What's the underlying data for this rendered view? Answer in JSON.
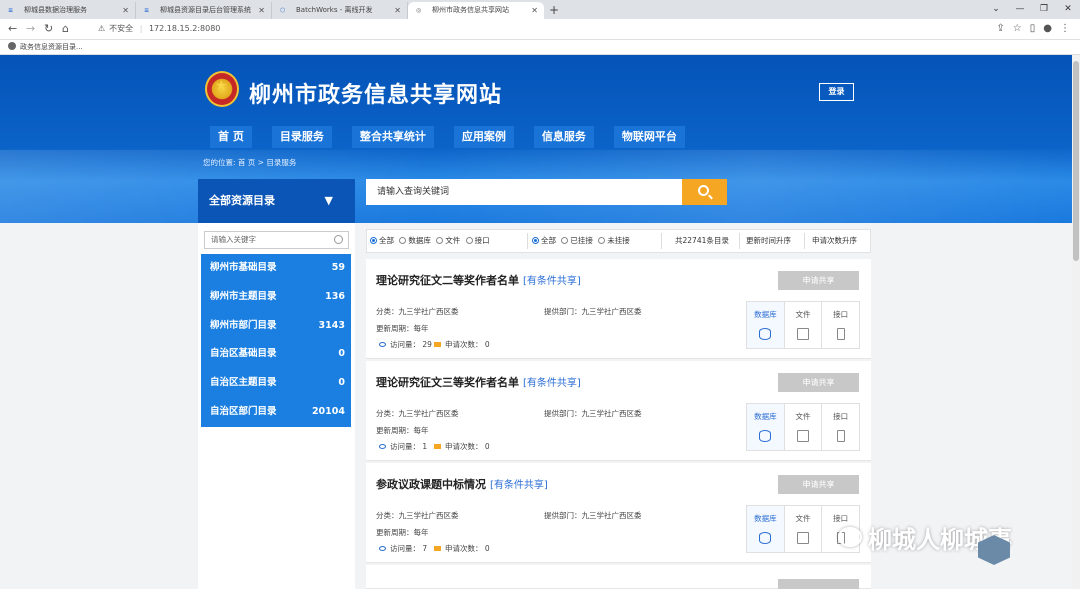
{
  "browser": {
    "tabs": [
      {
        "label": "柳城县数据治理服务",
        "active": false
      },
      {
        "label": "柳城县资源目录后台管理系统",
        "active": false
      },
      {
        "label": "BatchWorks - 离线开发",
        "active": false
      },
      {
        "label": "柳州市政务信息共享网站",
        "active": true
      }
    ],
    "new_tab": "+",
    "insecure_label": "不安全",
    "url": "172.18.15.2:8080",
    "bookmark": "政务信息资源目录..."
  },
  "header": {
    "site_title": "柳州市政务信息共享网站",
    "login": "登录",
    "nav": [
      "首 页",
      "目录服务",
      "整合共享统计",
      "应用案例",
      "信息服务",
      "物联网平台"
    ],
    "breadcrumb": "您的位置: 首 页 > 目录服务"
  },
  "catalog": {
    "title": "全部资源目录",
    "keyword_placeholder": "请输入关键字",
    "items": [
      {
        "name": "柳州市基础目录",
        "count": "59"
      },
      {
        "name": "柳州市主题目录",
        "count": "136"
      },
      {
        "name": "柳州市部门目录",
        "count": "3143"
      },
      {
        "name": "自治区基础目录",
        "count": "0"
      },
      {
        "name": "自治区主题目录",
        "count": "0"
      },
      {
        "name": "自治区部门目录",
        "count": "20104"
      }
    ]
  },
  "search": {
    "placeholder": "请输入查询关键词"
  },
  "filters": {
    "type_options": [
      "全部",
      "数据库",
      "文件",
      "接口"
    ],
    "mount_options": [
      "全部",
      "已挂接",
      "未挂接"
    ],
    "total": "共22741条目录",
    "sort_time": "更新时间升序",
    "sort_apply": "申请次数升序"
  },
  "results": [
    {
      "title": "理论研究征文二等奖作者名单",
      "tag": "[有条件共享]",
      "apply": "申请共享",
      "category": "分类：九三学社广西区委",
      "provider": "提供部门：九三学社广西区委",
      "period": "更新周期：每年",
      "views_label": "访问量：",
      "views": "29",
      "apply_label": "申请次数：",
      "apply_count": "0",
      "types": [
        "数据库",
        "文件",
        "接口"
      ]
    },
    {
      "title": "理论研究征文三等奖作者名单",
      "tag": "[有条件共享]",
      "apply": "申请共享",
      "category": "分类：九三学社广西区委",
      "provider": "提供部门：九三学社广西区委",
      "period": "更新周期：每年",
      "views_label": "访问量：",
      "views": "1",
      "apply_label": "申请次数：",
      "apply_count": "0",
      "types": [
        "数据库",
        "文件",
        "接口"
      ]
    },
    {
      "title": "参政议政课题中标情况",
      "tag": "[有条件共享]",
      "apply": "申请共享",
      "category": "分类：九三学社广西区委",
      "provider": "提供部门：九三学社广西区委",
      "period": "更新周期：每年",
      "views_label": "访问量：",
      "views": "7",
      "apply_label": "申请次数：",
      "apply_count": "0",
      "types": [
        "数据库",
        "文件",
        "接口"
      ]
    }
  ],
  "watermark": "柳城人柳城事",
  "icons": {
    "accent": "#1a7fe0",
    "search_button": "#f5a623"
  }
}
